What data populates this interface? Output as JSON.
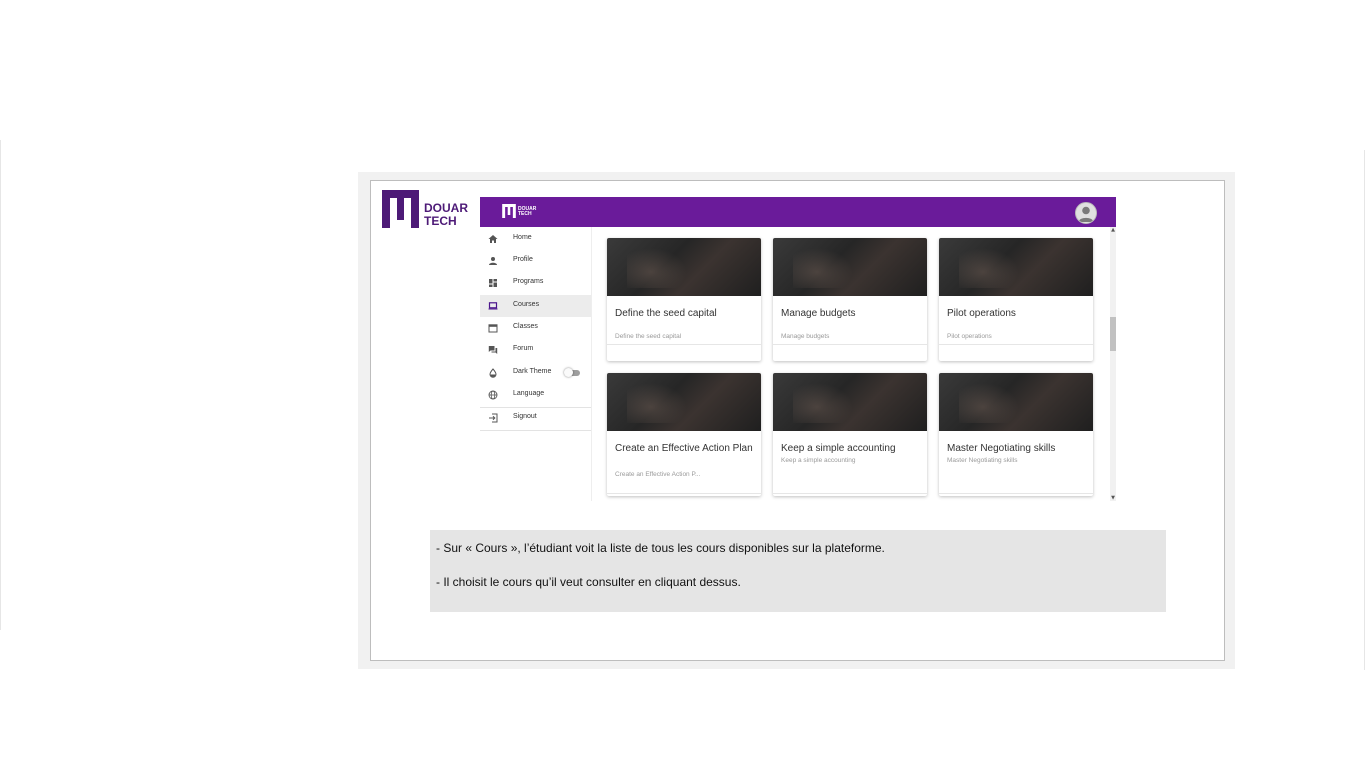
{
  "logo": {
    "line1": "DOUAR",
    "line2": "TECH"
  },
  "app": {
    "small_logo": {
      "line1": "DOUAR",
      "line2": "TECH"
    },
    "sidebar": {
      "items": [
        {
          "label": "Home",
          "icon": "home-icon"
        },
        {
          "label": "Profile",
          "icon": "person-icon"
        },
        {
          "label": "Programs",
          "icon": "dashboard-icon"
        },
        {
          "label": "Courses",
          "icon": "laptop-icon",
          "active": true
        },
        {
          "label": "Classes",
          "icon": "calendar-icon"
        },
        {
          "label": "Forum",
          "icon": "forum-icon"
        },
        {
          "label": "Dark Theme",
          "icon": "drop-icon",
          "toggle": false
        },
        {
          "label": "Language",
          "icon": "globe-icon"
        },
        {
          "label": "Signout",
          "icon": "signout-icon"
        }
      ]
    },
    "courses": [
      {
        "title": "Define the seed capital",
        "subtitle": "Define the seed capital"
      },
      {
        "title": "Manage budgets",
        "subtitle": "Manage budgets"
      },
      {
        "title": "Pilot operations",
        "subtitle": "Pilot operations"
      },
      {
        "title": "Create an Effective Action Plan",
        "subtitle": "Create an Effective Action P..."
      },
      {
        "title": "Keep a simple accounting",
        "subtitle": "Keep a simple accounting"
      },
      {
        "title": "Master Negotiating skills",
        "subtitle": "Master Negotiating skills"
      }
    ],
    "colors": {
      "topbar": "#6a1b9a",
      "logo": "#4d1a77"
    }
  },
  "caption": {
    "line1": "- Sur « Cours », l’étudiant voit la liste de tous les cours disponibles sur la plateforme.",
    "line2": "- Il choisit le cours qu’il veut consulter en cliquant dessus."
  }
}
